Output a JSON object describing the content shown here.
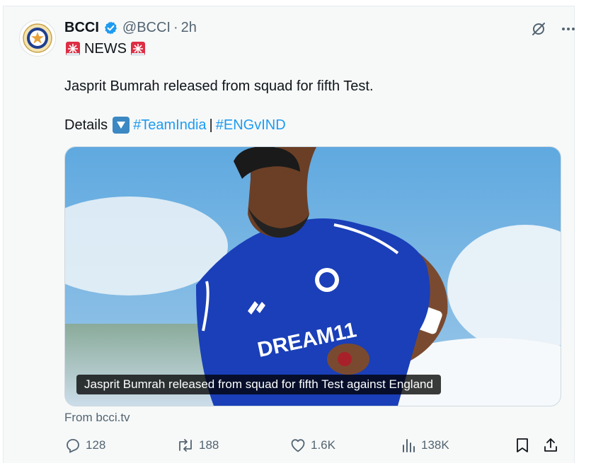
{
  "post": {
    "author_name": "BCCI",
    "handle": "@BCCI",
    "separator": "·",
    "time": "2h",
    "news_label": "NEWS",
    "text_line": "Jasprit Bumrah released from squad for fifth Test.",
    "details_label": "Details",
    "hashtag_1": "#TeamIndia",
    "divider": "|",
    "hashtag_2": "#ENGvIND"
  },
  "media": {
    "caption": "Jasprit Bumrah released from squad for fifth Test against England",
    "jersey_text": "DREAM11"
  },
  "source": "From bcci.tv",
  "metrics": {
    "replies": "128",
    "reposts": "188",
    "likes": "1.6K",
    "views": "138K"
  },
  "icons": [
    "grok-icon",
    "more-icon",
    "siren-icon",
    "down-arrow-icon",
    "reply-icon",
    "repost-icon",
    "like-icon",
    "views-icon",
    "bookmark-icon",
    "share-icon"
  ],
  "colors": {
    "accent": "#1d9bf0",
    "muted": "#536471",
    "verified": "#1d9bf0",
    "jersey": "#1a3fb8"
  }
}
